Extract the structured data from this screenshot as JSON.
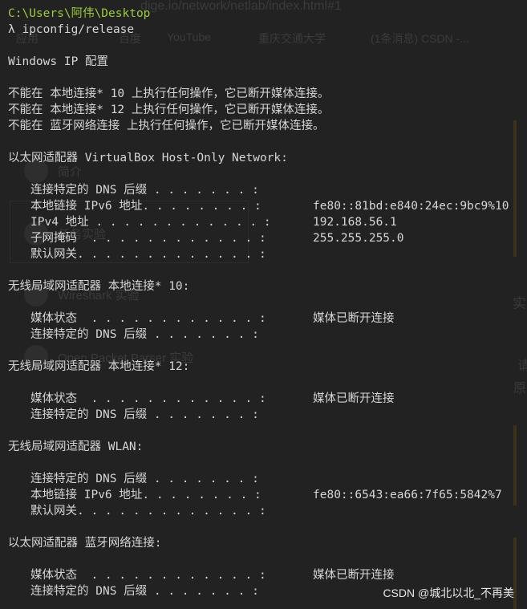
{
  "background_page": {
    "url_fragment": "dige.io/network/netlab/index.html#1",
    "bookmarks": [
      "应用",
      "百度",
      "YouTube",
      "重庆交通大学",
      "(1条消息) CSDN -..."
    ],
    "nav_items": [
      "简介",
      "任务实验",
      "Wireshark 实验",
      "Open Packet Parser 实验"
    ],
    "right_fragments": [
      "实",
      "请",
      "原"
    ]
  },
  "terminal": {
    "prompt_path": "C:\\Users\\阿伟\\Desktop",
    "prompt_symbol": "λ",
    "command": "ipconfig/release",
    "header": "Windows IP 配置",
    "notices": [
      "不能在 本地连接* 10 上执行任何操作，它已断开媒体连接。",
      "不能在 本地连接* 12 上执行任何操作，它已断开媒体连接。",
      "不能在 蓝牙网络连接 上执行任何操作，它已断开媒体连接。"
    ],
    "adapters": [
      {
        "title": "以太网适配器 VirtualBox Host-Only Network:",
        "rows": [
          {
            "label": "连接特定的 DNS 后缀 . . . . . . . :",
            "value": ""
          },
          {
            "label": "本地链接 IPv6 地址. . . . . . . . :",
            "value": "fe80::81bd:e840:24ec:9bc9%10"
          },
          {
            "label": "IPv4 地址 . . . . . . . . . . . . :",
            "value": "192.168.56.1"
          },
          {
            "label": "子网掩码  . . . . . . . . . . . . :",
            "value": "255.255.255.0"
          },
          {
            "label": "默认网关. . . . . . . . . . . . . :",
            "value": ""
          }
        ]
      },
      {
        "title": "无线局域网适配器 本地连接* 10:",
        "rows": [
          {
            "label": "媒体状态  . . . . . . . . . . . . :",
            "value": "媒体已断开连接"
          },
          {
            "label": "连接特定的 DNS 后缀 . . . . . . . :",
            "value": ""
          }
        ]
      },
      {
        "title": "无线局域网适配器 本地连接* 12:",
        "rows": [
          {
            "label": "媒体状态  . . . . . . . . . . . . :",
            "value": "媒体已断开连接"
          },
          {
            "label": "连接特定的 DNS 后缀 . . . . . . . :",
            "value": ""
          }
        ]
      },
      {
        "title": "无线局域网适配器 WLAN:",
        "rows": [
          {
            "label": "连接特定的 DNS 后缀 . . . . . . . :",
            "value": ""
          },
          {
            "label": "本地链接 IPv6 地址. . . . . . . . :",
            "value": "fe80::6543:ea66:7f65:5842%7"
          },
          {
            "label": "默认网关. . . . . . . . . . . . . :",
            "value": ""
          }
        ]
      },
      {
        "title": "以太网适配器 蓝牙网络连接:",
        "rows": [
          {
            "label": "媒体状态  . . . . . . . . . . . . :",
            "value": "媒体已断开连接"
          },
          {
            "label": "连接特定的 DNS 后缀 . . . . . . . :",
            "value": ""
          }
        ]
      }
    ]
  },
  "watermark": "CSDN @城北以北_不再美",
  "colors": {
    "background": "#222222",
    "text": "#d6d6d6",
    "prompt_path": "#9ccc3c",
    "ghost_text": "#3b3b3b"
  }
}
